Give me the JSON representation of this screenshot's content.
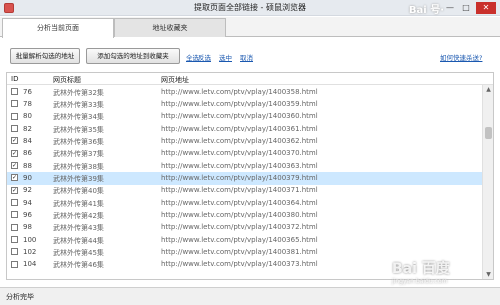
{
  "window": {
    "title": "提取页面全部链接 - 硕鼠浏览器",
    "min_glyph": "—",
    "max_glyph": "□",
    "close_glyph": "✕",
    "watermark_top": "Bai 号·"
  },
  "tabs": [
    {
      "label": "分析当前页面",
      "active": true
    },
    {
      "label": "地址收藏夹",
      "active": false
    }
  ],
  "toolbar": {
    "batch_parse_label": "批量解析勾选的地址",
    "add_favorites_label": "添加勾选的地址到收藏夹",
    "select_all": "全选",
    "invert": "反选",
    "select_some": "选中",
    "cancel": "取消",
    "how_to_collect": "如何快速杀送?"
  },
  "table": {
    "headers": {
      "id": "ID",
      "title": "网页标题",
      "url": "网页地址"
    },
    "rows": [
      {
        "id": "76",
        "title": "武林外传第32集",
        "url": "http://www.letv.com/ptv/vplay/1400358.html",
        "checked": false,
        "selected": false
      },
      {
        "id": "78",
        "title": "武林外传第33集",
        "url": "http://www.letv.com/ptv/vplay/1400359.html",
        "checked": false,
        "selected": false
      },
      {
        "id": "80",
        "title": "武林外传第34集",
        "url": "http://www.letv.com/ptv/vplay/1400360.html",
        "checked": false,
        "selected": false
      },
      {
        "id": "82",
        "title": "武林外传第35集",
        "url": "http://www.letv.com/ptv/vplay/1400361.html",
        "checked": false,
        "selected": false
      },
      {
        "id": "84",
        "title": "武林外传第36集",
        "url": "http://www.letv.com/ptv/vplay/1400362.html",
        "checked": true,
        "selected": false
      },
      {
        "id": "86",
        "title": "武林外传第37集",
        "url": "http://www.letv.com/ptv/vplay/1400370.html",
        "checked": true,
        "selected": false
      },
      {
        "id": "88",
        "title": "武林外传第38集",
        "url": "http://www.letv.com/ptv/vplay/1400363.html",
        "checked": true,
        "selected": false
      },
      {
        "id": "90",
        "title": "武林外传第39集",
        "url": "http://www.letv.com/ptv/vplay/1400379.html",
        "checked": true,
        "selected": true
      },
      {
        "id": "92",
        "title": "武林外传第40集",
        "url": "http://www.letv.com/ptv/vplay/1400371.html",
        "checked": true,
        "selected": false
      },
      {
        "id": "94",
        "title": "武林外传第41集",
        "url": "http://www.letv.com/ptv/vplay/1400364.html",
        "checked": false,
        "selected": false
      },
      {
        "id": "96",
        "title": "武林外传第42集",
        "url": "http://www.letv.com/ptv/vplay/1400380.html",
        "checked": false,
        "selected": false
      },
      {
        "id": "98",
        "title": "武林外传第43集",
        "url": "http://www.letv.com/ptv/vplay/1400372.html",
        "checked": false,
        "selected": false
      },
      {
        "id": "100",
        "title": "武林外传第44集",
        "url": "http://www.letv.com/ptv/vplay/1400365.html",
        "checked": false,
        "selected": false
      },
      {
        "id": "102",
        "title": "武林外传第45集",
        "url": "http://www.letv.com/ptv/vplay/1400381.html",
        "checked": false,
        "selected": false
      },
      {
        "id": "104",
        "title": "武林外传第46集",
        "url": "http://www.letv.com/ptv/vplay/1400373.html",
        "checked": false,
        "selected": false
      }
    ]
  },
  "scrollbar": {
    "up": "▲",
    "down": "▼"
  },
  "status": {
    "text": "分析完毕"
  },
  "watermark": {
    "text": "Bai 百度",
    "sub": "jingyan.baidu.com"
  },
  "colors": {
    "selected_row": "#cde8ff",
    "link": "#1a58b0",
    "close_button": "#c9302c"
  }
}
